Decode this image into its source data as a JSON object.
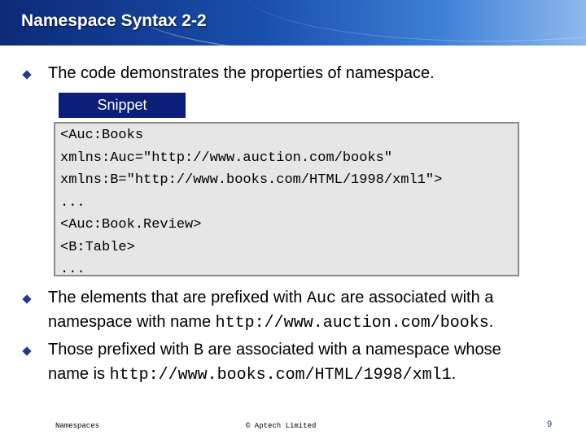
{
  "title": "Namespace Syntax 2-2",
  "bullet1": "The code demonstrates the properties of namespace.",
  "snippet_label": "Snippet",
  "code_lines": [
    "<Auc:Books",
    "xmlns:Auc=\"http://www.auction.com/books\"",
    "xmlns:B=\"http://www.books.com/HTML/1998/xml1\">",
    "...",
    "<Auc:Book.Review>",
    "<B:Table>",
    "..."
  ],
  "bullet2": {
    "part1": "The elements that are prefixed with ",
    "code1": "Auc",
    "part2": " are associated with a",
    "part3": "namespace with name ",
    "code2": "http://www.auction.com/books",
    "part4": "."
  },
  "bullet3": {
    "part1": "Those prefixed with ",
    "code1": "B",
    "part2": " are associated with a namespace whose",
    "part3": "name is ",
    "code2": "http://www.books.com/HTML/1998/xml1",
    "part4": "."
  },
  "footer": {
    "left": "Namespaces",
    "center": "© Aptech Limited",
    "page": "9"
  },
  "colors": {
    "title_bar": "#1a4fae",
    "snippet_tab": "#0b1f7a",
    "code_bg": "#e6e6e6",
    "bullet": "#1f3a8a"
  }
}
